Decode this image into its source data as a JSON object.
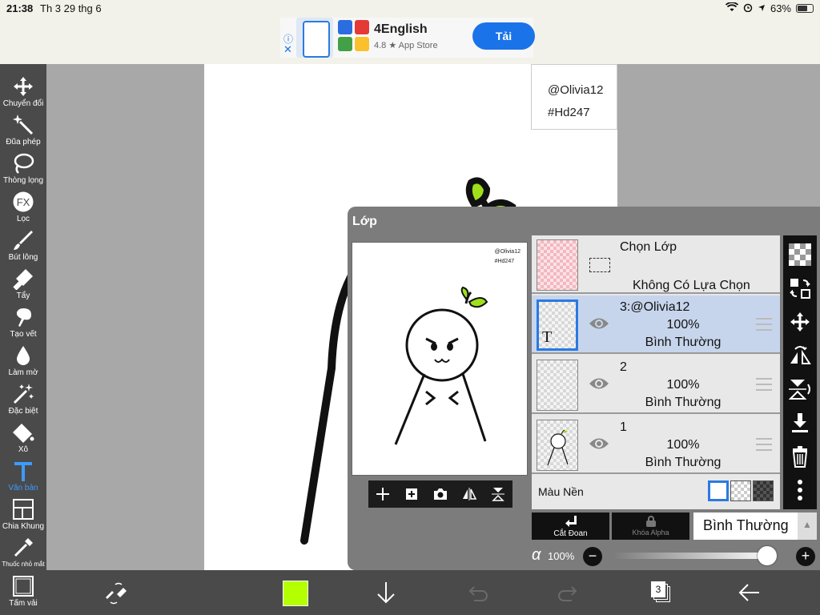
{
  "status": {
    "time": "21:38",
    "date": "Th 3 29 thg 6",
    "battery": "63%"
  },
  "ad": {
    "title": "4English",
    "rating": "4.8 ★ App Store",
    "cta": "Tải"
  },
  "tools": [
    {
      "label": "Chuyển đổi",
      "icon": "move-icon"
    },
    {
      "label": "Đũa phép",
      "icon": "magic-wand-icon"
    },
    {
      "label": "Thòng lọng",
      "icon": "lasso-icon"
    },
    {
      "label": "Lọc",
      "icon": "fx-filter-icon"
    },
    {
      "label": "Bút lông",
      "icon": "brush-icon"
    },
    {
      "label": "Tẩy",
      "icon": "eraser-icon"
    },
    {
      "label": "Tạo vết",
      "icon": "smudge-icon"
    },
    {
      "label": "Làm mờ",
      "icon": "blur-drop-icon"
    },
    {
      "label": "Đặc biệt",
      "icon": "special-brush-icon"
    },
    {
      "label": "Xô",
      "icon": "bucket-icon"
    },
    {
      "label": "Văn bản",
      "icon": "text-icon"
    },
    {
      "label": "Chia Khung",
      "icon": "frame-divider-icon"
    },
    {
      "label": "Thuốc nhỏ mắt",
      "icon": "eyedropper-icon"
    },
    {
      "label": "Tấm vải",
      "icon": "canvas-icon"
    }
  ],
  "canvas": {
    "watermark_line1": "@Olivia12",
    "watermark_line2": "#Hd247"
  },
  "layers_panel": {
    "title": "Lớp",
    "preview_watermark_line1": "@Olivia12",
    "preview_watermark_line2": "#Hd247",
    "selection": {
      "title": "Chọn Lớp",
      "subtitle": "Không Có Lựa Chọn"
    },
    "layers": [
      {
        "name": "3:@Olivia12",
        "opacity": "100%",
        "mode": "Bình Thường",
        "selected": true,
        "type_badge": "T"
      },
      {
        "name": "2",
        "opacity": "100%",
        "mode": "Bình Thường",
        "selected": false
      },
      {
        "name": "1",
        "opacity": "100%",
        "mode": "Bình Thường",
        "selected": false
      }
    ],
    "background_label": "Màu Nền",
    "clip_label": "Cắt Đoan",
    "alpha_lock_label": "Khóa Alpha",
    "blend_mode": "Bình Thường",
    "alpha_symbol": "α",
    "alpha_value": "100%",
    "alpha_level": 1.0
  },
  "bottom": {
    "layer_count": "3",
    "color": "#b4ff00"
  },
  "colors": {
    "accent": "#2a7ae2",
    "toolbar": "#4a4a4a",
    "panel": "#7c7c7c"
  }
}
